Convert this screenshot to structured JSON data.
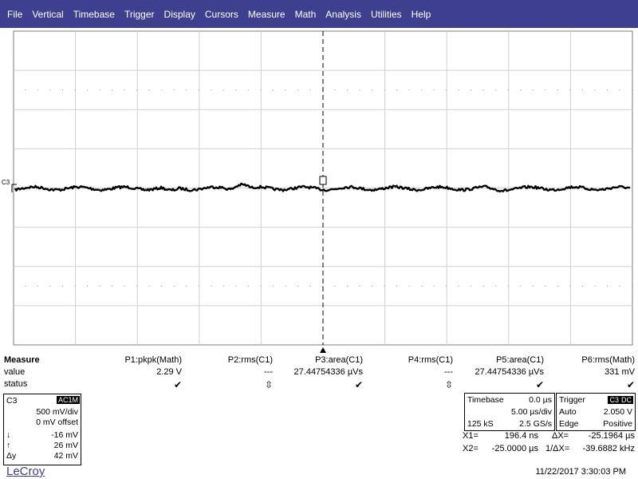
{
  "menu": [
    "File",
    "Vertical",
    "Timebase",
    "Trigger",
    "Display",
    "Cursors",
    "Measure",
    "Math",
    "Analysis",
    "Utilities",
    "Help"
  ],
  "scope": {
    "channel_label": "C3",
    "trace_color": "#000000"
  },
  "measure": {
    "title": "Measure",
    "row_labels": [
      "value",
      "status"
    ],
    "columns": [
      {
        "name": "P1:pkpk(Math)",
        "value": "2.29 V",
        "status": "check"
      },
      {
        "name": "P2:rms(C1)",
        "value": "---",
        "status": "diamond"
      },
      {
        "name": "P3:area(C1)",
        "value": "27.44754336 µVs",
        "status": "check"
      },
      {
        "name": "P4:rms(C1)",
        "value": "---",
        "status": "diamond"
      },
      {
        "name": "P5:area(C1)",
        "value": "27.44754336 µVs",
        "status": "check"
      },
      {
        "name": "P6:rms(Math)",
        "value": "331 mV",
        "status": "check"
      }
    ]
  },
  "channel": {
    "name": "C3",
    "coupling": "AC1M",
    "vdiv": "500 mV/div",
    "offset": "0 mV offset",
    "down_label": "↓",
    "down_value": "-16 mV",
    "up_label": "↑",
    "up_value": "26 mV",
    "dy_label": "Δy",
    "dy_value": "42 mV"
  },
  "timebase": {
    "label": "Timebase",
    "delay": "0.0 µs",
    "tdiv": "5.00 µs/div",
    "samples": "125 kS",
    "rate": "2.5 GS/s"
  },
  "trigger": {
    "label": "Trigger",
    "channel": "C3",
    "coupling": "DC",
    "mode": "Auto",
    "level": "2.050 V",
    "type": "Edge",
    "slope": "Positive"
  },
  "cursors": {
    "x1_label": "X1=",
    "x1": "196.4 ns",
    "dx_label": "ΔX=",
    "dx": "-25.1964 µs",
    "x2_label": "X2=",
    "x2": "-25.0000 µs",
    "inv_label": "1/ΔX=",
    "inv": "-39.6882 kHz"
  },
  "footer": {
    "brand": "LeCroy",
    "datetime": "11/22/2017 3:30:03 PM"
  }
}
